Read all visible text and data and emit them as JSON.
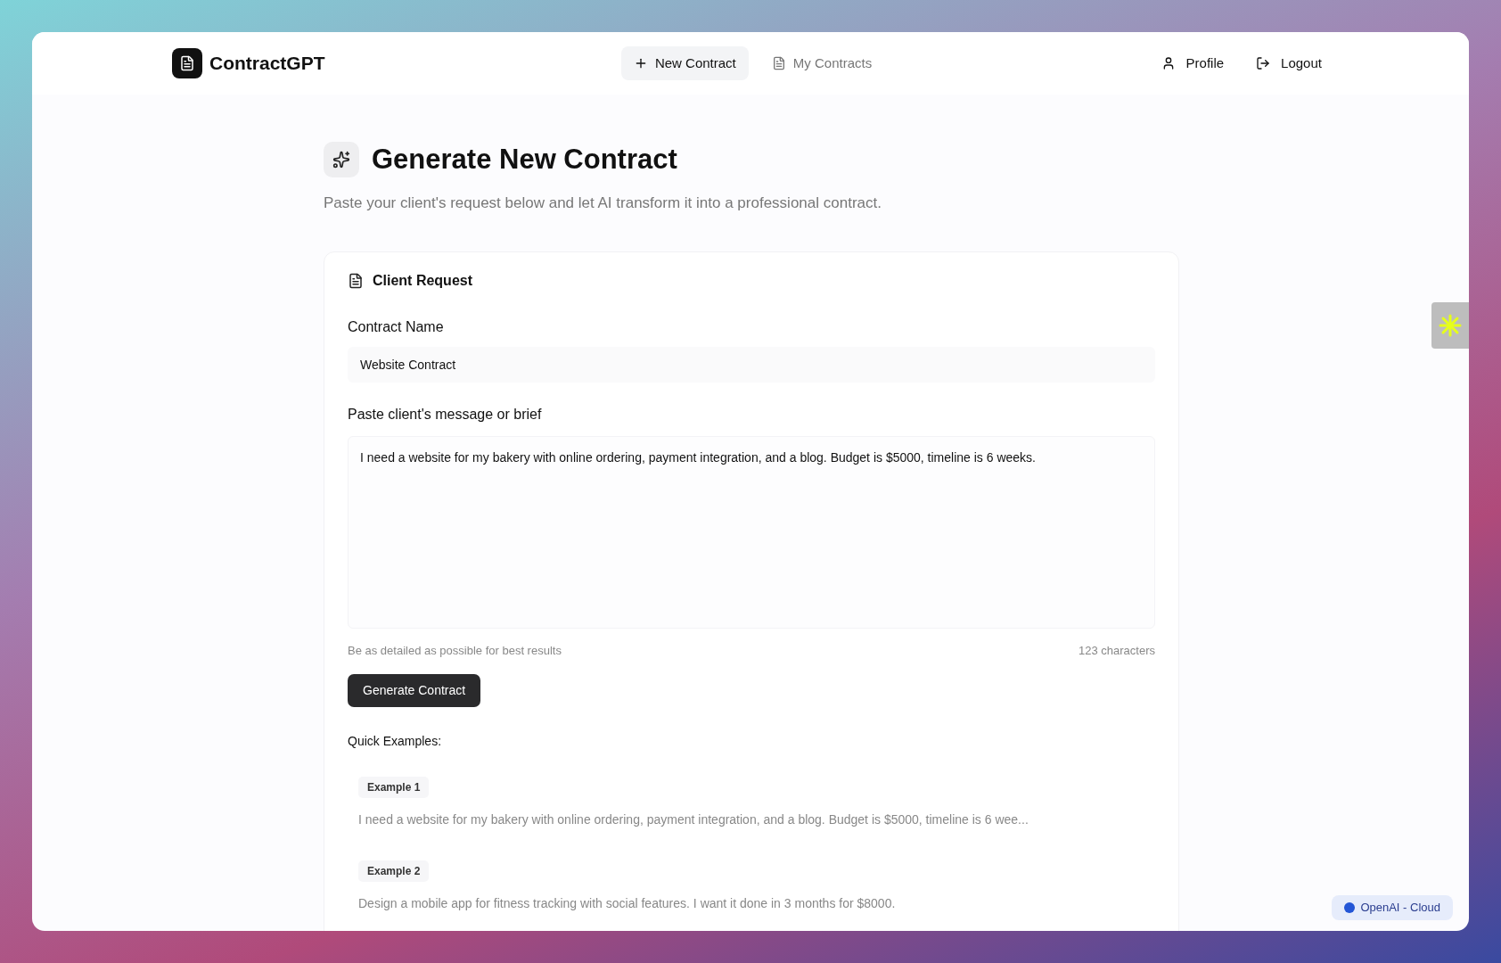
{
  "app": {
    "name": "ContractGPT"
  },
  "nav": [
    {
      "label": "New Contract",
      "selected": true
    },
    {
      "label": "My Contracts",
      "selected": false
    }
  ],
  "user_menu": [
    {
      "label": "Profile"
    },
    {
      "label": "Logout"
    }
  ],
  "page": {
    "title": "Generate New Contract",
    "subtitle": "Paste your client's request below and let AI transform it into a professional contract."
  },
  "card": {
    "title": "Client Request",
    "fields": [
      {
        "label": "Contract Name",
        "kind": "input",
        "value": "Website Contract"
      },
      {
        "label": "Paste client's message or brief",
        "kind": "textarea",
        "value": "I need a website for my bakery with online ordering, payment integration, and a blog. Budget is $5000, timeline is 6 weeks."
      }
    ],
    "hint": "Be as detailed as possible for best results",
    "count": "123 characters",
    "button": "Generate Contract",
    "examples_title": "Quick Examples:",
    "examples": [
      {
        "label": "Example 1",
        "text": "I need a website for my bakery with online ordering, payment integration, and a blog. Budget is $5000, timeline is 6 wee..."
      },
      {
        "label": "Example 2",
        "text": "Design a mobile app for fitness tracking with social features. I want it done in 3 months for $8000."
      }
    ]
  },
  "status_badge": {
    "label": "OpenAI - Cloud"
  }
}
